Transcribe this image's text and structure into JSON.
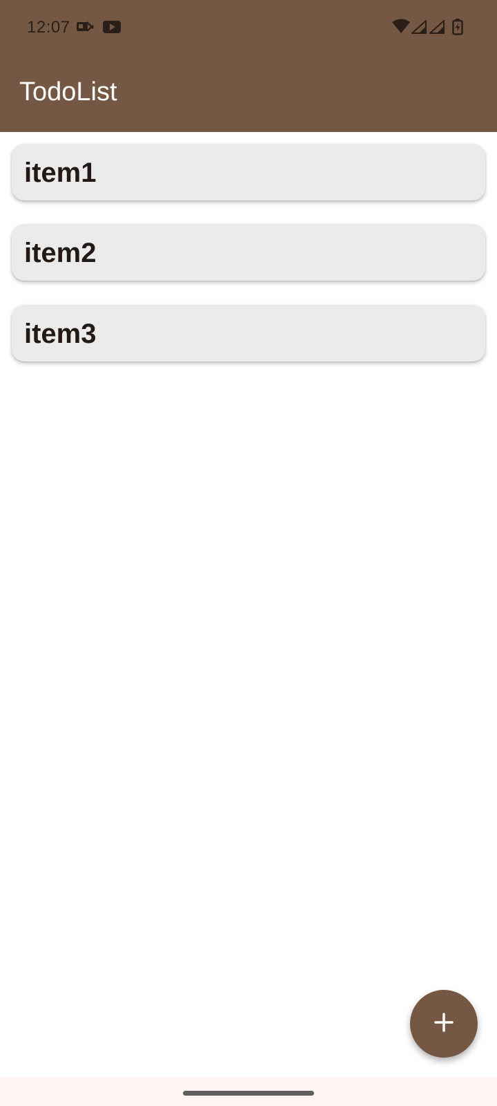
{
  "status_bar": {
    "time": "12:07",
    "icons": [
      "nfc-pay-icon",
      "youtube-icon",
      "wifi-icon",
      "signal-icon",
      "signal-icon",
      "battery-charging-icon"
    ]
  },
  "app_bar": {
    "title": "TodoList"
  },
  "todo_items": [
    {
      "label": "item1"
    },
    {
      "label": "item2"
    },
    {
      "label": "item3"
    }
  ],
  "fab": {
    "icon": "plus-icon"
  },
  "colors": {
    "primary": "#745844",
    "card": "#ebebeb",
    "text": "#231a15",
    "nav_bar": "#fff5f3"
  }
}
